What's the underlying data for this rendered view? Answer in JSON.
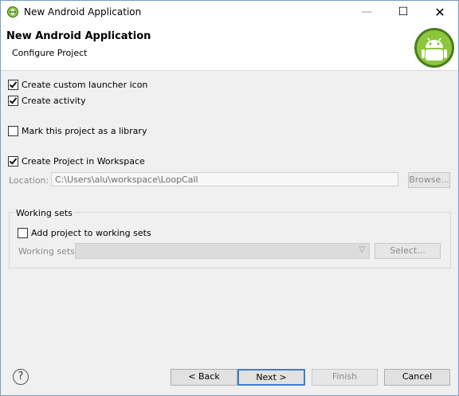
{
  "window": {
    "title": "New Android Application",
    "minimize_glyph": "—",
    "maximize_glyph": "☐",
    "close_glyph": "✕"
  },
  "header": {
    "title": "New Android Application",
    "subtitle": "Configure Project"
  },
  "options": {
    "custom_launcher_icon": {
      "label": "Create custom launcher icon",
      "checked": true
    },
    "create_activity": {
      "label": "Create activity",
      "checked": true
    },
    "library": {
      "label": "Mark this project as a library",
      "checked": false
    },
    "in_workspace": {
      "label": "Create Project in Workspace",
      "checked": true
    }
  },
  "location": {
    "label": "Location:",
    "value": "C:\\Users\\alu\\workspace\\LoopCall",
    "browse_label": "Browse..."
  },
  "working_sets": {
    "group_title": "Working sets",
    "add_label": "Add project to working sets",
    "add_checked": false,
    "sets_label": "Working sets:",
    "selected_value": "",
    "select_label": "Select..."
  },
  "footer": {
    "help_glyph": "?",
    "back_label": "< Back",
    "next_label": "Next >",
    "finish_label": "Finish",
    "cancel_label": "Cancel"
  },
  "colors": {
    "accent": "#3c7fd1",
    "android_green": "#8cc63f"
  },
  "icons": {
    "app": "eclipse-icon",
    "banner": "android-logo-icon",
    "help": "help-icon"
  }
}
